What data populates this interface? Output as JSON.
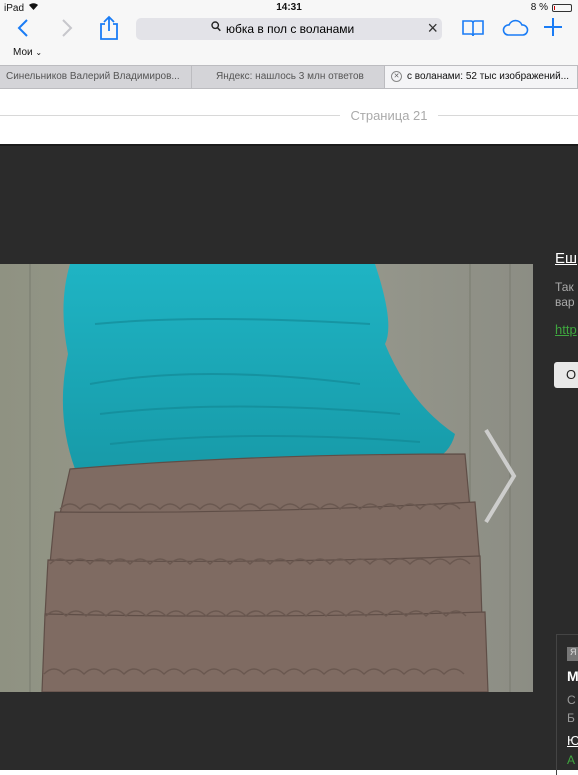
{
  "status": {
    "device": "iPad",
    "time": "14:31",
    "battery": "8 %",
    "battery_level": 0.08
  },
  "toolbar": {
    "back": "back-icon",
    "forward": "forward-icon",
    "share": "share-icon",
    "search_query": "юбка в пол с воланами",
    "bookmarks": "book-icon",
    "cloud": "cloud-icon",
    "new_tab": "plus-icon",
    "moi_label": "Мои"
  },
  "tabs": [
    {
      "label": "Синельников Валерий Владимиров...",
      "active": false
    },
    {
      "label": "Яндекс: нашлось 3 млн ответов",
      "active": false
    },
    {
      "label": "с воланами: 52 тыс изображений...",
      "active": true
    }
  ],
  "page": {
    "label": "Страница 21"
  },
  "viewer": {
    "side_title": "Еш",
    "side_desc_1": "Так",
    "side_desc_2": "вар",
    "side_url": "http",
    "side_button": "О"
  },
  "card": {
    "badge": "Я",
    "title": "М",
    "line1": "С",
    "line2": "Б",
    "link": "Ю",
    "green": "А"
  },
  "colors": {
    "accent": "#1a7cf5",
    "viewer_bg": "#2b2b2b",
    "link_green": "#3fa63f",
    "shirt": "#20a9b8",
    "skirt": "#7f6b62"
  }
}
